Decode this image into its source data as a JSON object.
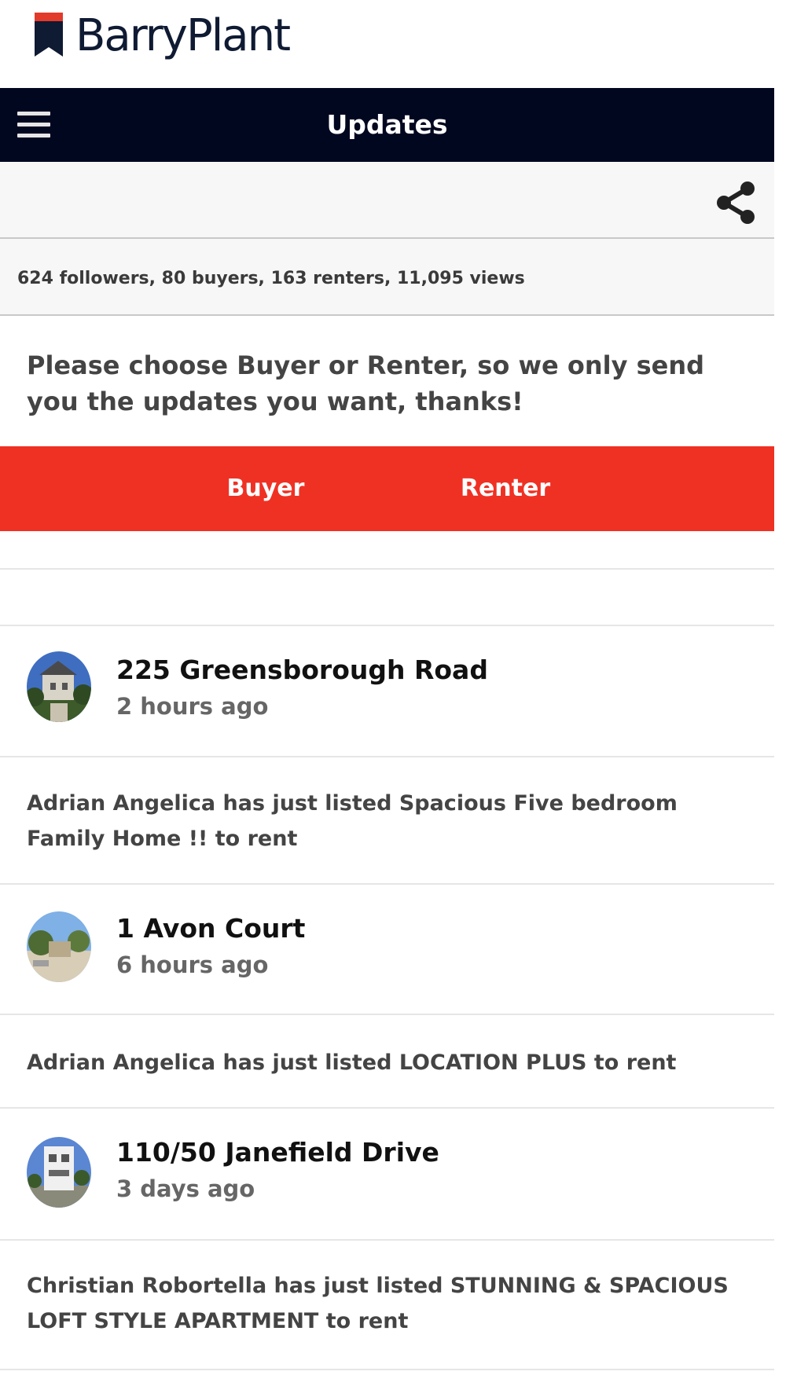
{
  "logo": {
    "text": "BarryPlant"
  },
  "navbar": {
    "title": "Updates"
  },
  "stats": {
    "text": "624 followers, 80 buyers, 163 renters, 11,095 views"
  },
  "prompt": {
    "text": "Please choose Buyer or Renter, so we only send you the updates you want, thanks!"
  },
  "choices": {
    "buyer": "Buyer",
    "renter": "Renter"
  },
  "feed": [
    {
      "title": "225 Greensborough Road",
      "time": "2 hours ago",
      "body": "Adrian Angelica has just listed Spacious Five bedroom Family Home !! to rent"
    },
    {
      "title": "1 Avon Court",
      "time": "6 hours ago",
      "body": "Adrian Angelica has just listed LOCATION PLUS to rent"
    },
    {
      "title": "110/50 Janefield Drive",
      "time": "3 days ago",
      "body": "Christian  Robortella has just listed STUNNING & SPACIOUS LOFT STYLE APARTMENT to rent"
    }
  ],
  "colors": {
    "navbar": "#020720",
    "accent": "#ef3124",
    "brand": "#0f1a33"
  },
  "icons": {
    "menu": "hamburger-menu-icon",
    "share": "share-icon"
  }
}
